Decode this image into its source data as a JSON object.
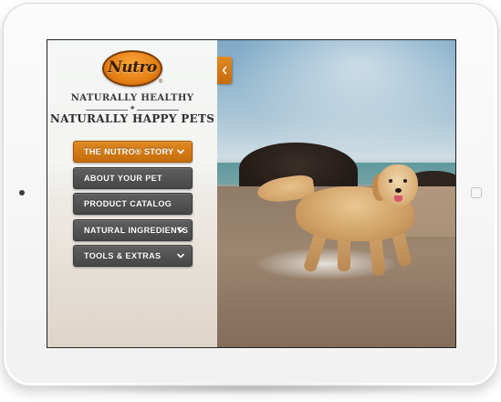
{
  "brand": {
    "logo_text": "Nutro",
    "registered_mark": "®",
    "tagline_top": "NATURALLY HEALTHY",
    "tagline_divider": "★",
    "tagline_bottom": "NATURALLY HAPPY PETS",
    "accent_color": "#d97a18"
  },
  "menu": {
    "items": [
      {
        "label": "THE NUTRO® STORY",
        "active": true,
        "has_chevron": true,
        "icon": "chevron-down-icon"
      },
      {
        "label": "ABOUT YOUR PET",
        "active": false,
        "has_chevron": false
      },
      {
        "label": "PRODUCT CATALOG",
        "active": false,
        "has_chevron": false
      },
      {
        "label": "NATURAL INGREDIENTS",
        "active": false,
        "has_chevron": true,
        "icon": "chevron-down-icon"
      },
      {
        "label": "TOOLS & EXTRAS",
        "active": false,
        "has_chevron": true,
        "icon": "chevron-down-icon"
      }
    ]
  },
  "collapse_tab": {
    "icon": "chevron-left-icon"
  },
  "hero_image": {
    "subject": "golden retriever on beach"
  }
}
